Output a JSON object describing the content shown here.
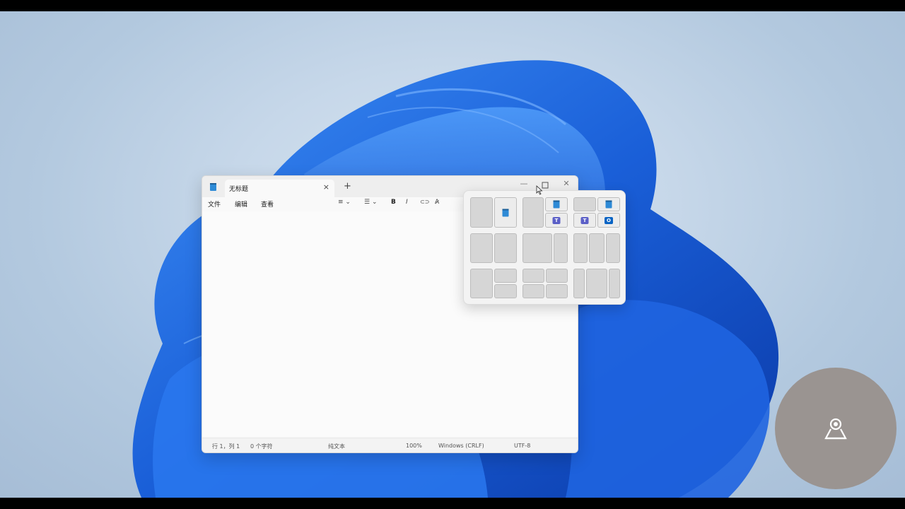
{
  "window": {
    "tab_title": "无标题",
    "tab_close": "×",
    "new_tab": "+",
    "minimize": "—",
    "maximize": "▫",
    "close": "✕"
  },
  "menu": {
    "file": "文件",
    "edit": "编辑",
    "view": "查看"
  },
  "toolbar": {
    "heading": "≡",
    "list": "☰",
    "bold": "B",
    "italic": "I",
    "link": "⊂⊃",
    "clear_format": "A̷"
  },
  "status": {
    "position": "行 1，列 1",
    "chars": "0 个字符",
    "format": "纯文本",
    "zoom": "100%",
    "line_ending": "Windows (CRLF)",
    "encoding": "UTF-8"
  },
  "colors": {
    "accent": "#2e8ad6",
    "wallpaper_bloom": "#1a5fd8",
    "webcam_bg": "#9a9491"
  },
  "snap_layouts": {
    "apps": [
      "notepad-icon",
      "teams-icon",
      "outlook-icon"
    ]
  }
}
